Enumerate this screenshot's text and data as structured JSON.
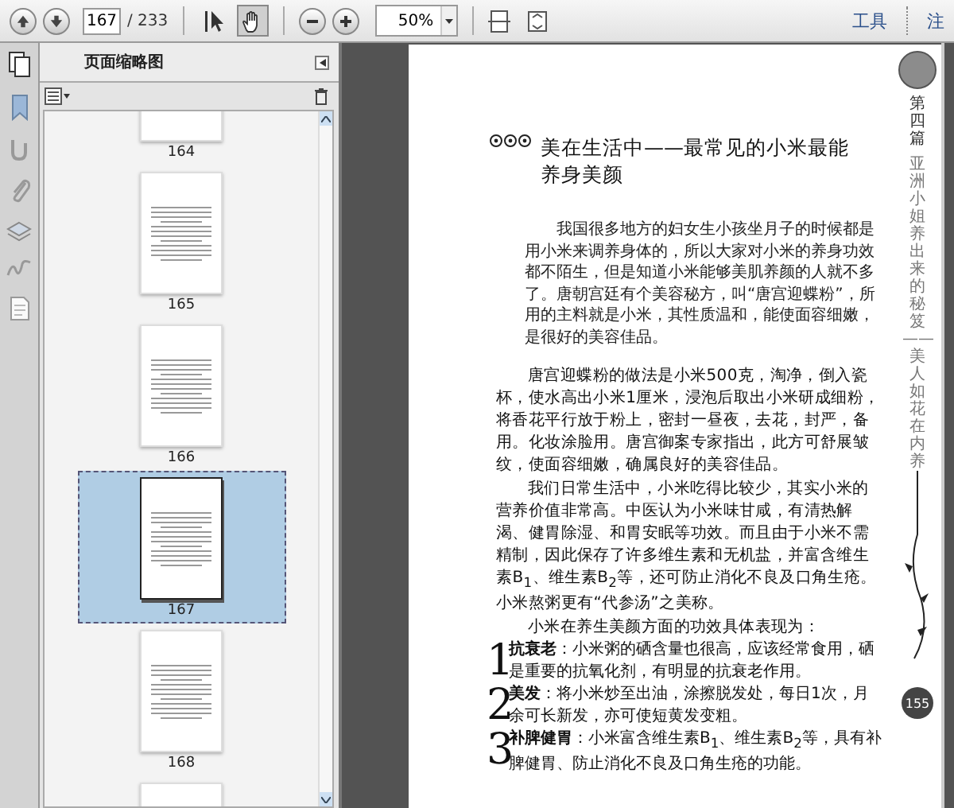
{
  "toolbar": {
    "page_input": "167",
    "page_total": "/ 233",
    "zoom": "50%",
    "tools": [
      {
        "kind": "select",
        "selected": false
      },
      {
        "kind": "hand",
        "selected": true
      }
    ],
    "links": [
      "工具",
      "注"
    ]
  },
  "sidebar": {
    "title": "页面缩略图",
    "thumbnails": [
      {
        "label": "164",
        "kind": "text",
        "selected": false
      },
      {
        "label": "165",
        "kind": "text",
        "selected": false
      },
      {
        "label": "166",
        "kind": "text",
        "selected": false
      },
      {
        "label": "167",
        "kind": "text",
        "selected": true
      },
      {
        "label": "168",
        "kind": "text",
        "selected": false
      },
      {
        "kind": "art",
        "selected": false
      }
    ]
  },
  "page": {
    "title": "美在生活中——最常见的小米最能养身美颜",
    "intro": "我国很多地方的妇女生小孩坐月子的时候都是用小米来调养身体的，所以大家对小米的养身功效都不陌生，但是知道小米能够美肌养颜的人就不多了。唐朝宫廷有个美容秘方，叫“唐宫迎蝶粉”，所用的主料就是小米，其性质温和，能使面容细嫩，是很好的美容佳品。",
    "paragraphs": [
      "唐宫迎蝶粉的做法是小米500克，淘净，倒入瓷杯，使水高出小米1厘米，浸泡后取出小米研成细粉，将香花平行放于粉上，密封一昼夜，去花，封严，备用。化妆涂脸用。唐宫御案专家指出，此方可舒展皱纹，使面容细嫩，确属良好的美容佳品。",
      "我们日常生活中，小米吃得比较少，其实小米的营养价值非常高。中医认为小米味甘咸，有清热解渴、健胃除湿、和胃安眠等功效。而且由于小米不需精制，因此保存了许多维生素和无机盐，并富含维生素B$_{1}$、维生素B$_{2}$等，还可防止消化不良及口角生疮。小米熬粥更有“代参汤”之美称。",
      "小米在养生美颜方面的功效具体表现为："
    ],
    "list": [
      {
        "number": "1",
        "text": "**抗衰老**：小米粥的硒含量也很高，应该经常食用，硒是重要的抗氧化剂，有明显的抗衰老作用。"
      },
      {
        "number": "2",
        "text": "**美发**：将小米炒至出油，涂擦脱发处，每日1次，月余可长新发，亦可使短黄发变粗。"
      },
      {
        "number": "3",
        "text": "**补脾健胃**：小米富含维生素B$_{1}$、维生素B$_{2}$等，具有补脾健胃、防止消化不良及口角生疮的功能。"
      }
    ],
    "side_heading": "第四篇",
    "side_text": "亚洲小姐养出来的秘笈——美人如花在内养",
    "page_number": "155"
  }
}
